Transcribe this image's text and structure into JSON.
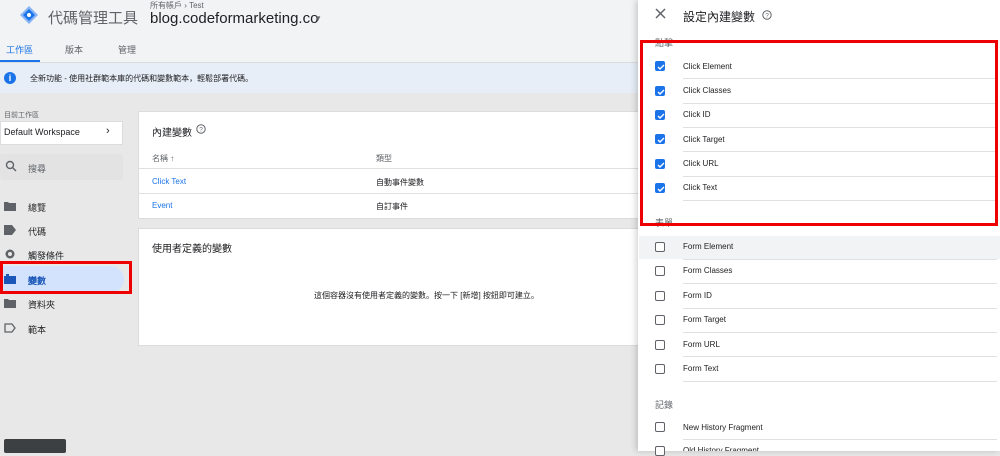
{
  "header": {
    "app_title": "代碼管理工具",
    "account_label": "所有帳戶 › Test",
    "container_name": "blog.codeformarketing.co"
  },
  "tabs": [
    {
      "label": "工作區",
      "active": true
    },
    {
      "label": "版本",
      "active": false
    },
    {
      "label": "管理",
      "active": false
    }
  ],
  "banner": {
    "text": "全新功能 - 使用社群範本庫的代碼和變數範本，輕鬆部署代碼。"
  },
  "sidebar": {
    "workspace_label": "目前工作區",
    "workspace_name": "Default Workspace",
    "search_placeholder": "搜尋",
    "items": [
      {
        "label": "總覽",
        "icon": "folder-icon"
      },
      {
        "label": "代碼",
        "icon": "tag-icon"
      },
      {
        "label": "觸發條件",
        "icon": "trigger-icon"
      },
      {
        "label": "變數",
        "icon": "variables-icon",
        "selected": true
      },
      {
        "label": "資料夾",
        "icon": "folder-icon"
      },
      {
        "label": "範本",
        "icon": "template-icon"
      }
    ]
  },
  "builtin_card": {
    "title": "內建變數",
    "col_name": "名稱",
    "col_type": "類型",
    "rows": [
      {
        "name": "Click Text",
        "type": "自動事件變數"
      },
      {
        "name": "Event",
        "type": "自訂事件"
      }
    ]
  },
  "user_card": {
    "title": "使用者定義的變數",
    "empty_message": "這個容器沒有使用者定義的變數。按一下 [新增] 按鈕即可建立。"
  },
  "panel": {
    "title": "設定內建變數",
    "sections": [
      {
        "label": "點擊",
        "items": [
          {
            "label": "Click Element",
            "checked": true
          },
          {
            "label": "Click Classes",
            "checked": true
          },
          {
            "label": "Click ID",
            "checked": true
          },
          {
            "label": "Click Target",
            "checked": true
          },
          {
            "label": "Click URL",
            "checked": true
          },
          {
            "label": "Click Text",
            "checked": true
          }
        ]
      },
      {
        "label": "表單",
        "items": [
          {
            "label": "Form Element",
            "checked": false
          },
          {
            "label": "Form Classes",
            "checked": false
          },
          {
            "label": "Form ID",
            "checked": false
          },
          {
            "label": "Form Target",
            "checked": false
          },
          {
            "label": "Form URL",
            "checked": false
          },
          {
            "label": "Form Text",
            "checked": false
          }
        ]
      },
      {
        "label": "記錄",
        "items": [
          {
            "label": "New History Fragment",
            "checked": false
          },
          {
            "label": "Old History Fragment",
            "checked": false
          }
        ]
      }
    ]
  },
  "colors": {
    "accent": "#1a73e8",
    "highlight": "#e00000"
  }
}
